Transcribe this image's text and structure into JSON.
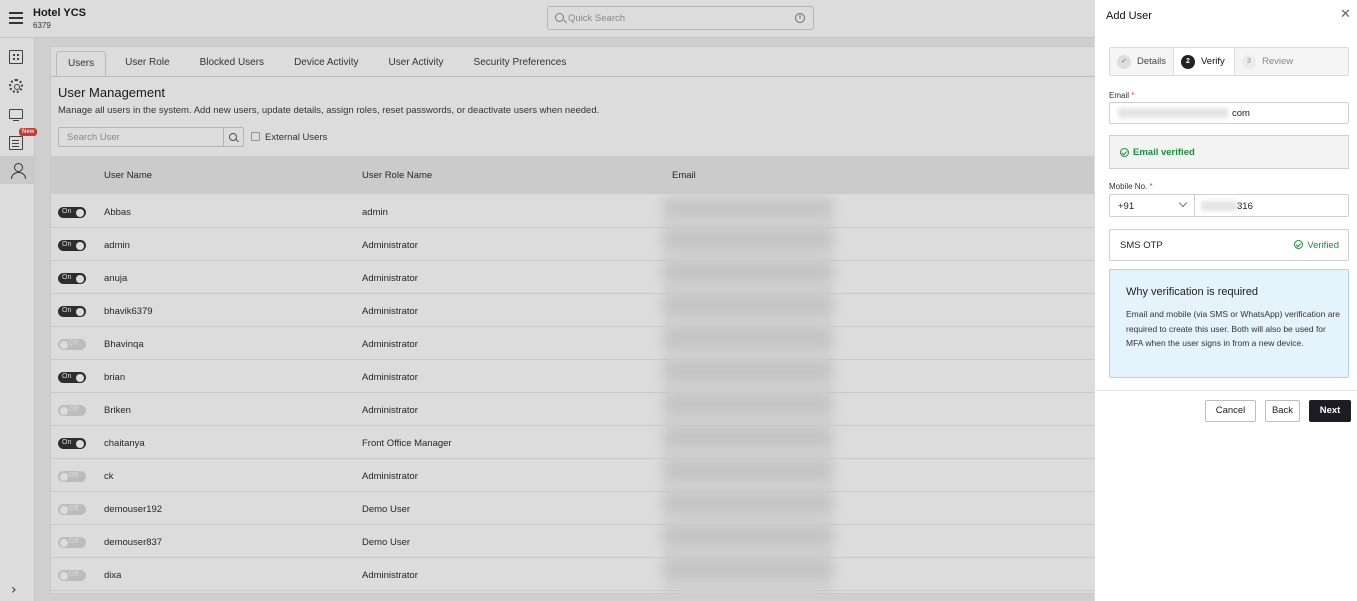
{
  "app": {
    "hotel_name": "Hotel YCS",
    "hotel_code": "6379",
    "quick_search_placeholder": "Quick Search",
    "new_badge": "New"
  },
  "tabs": [
    {
      "label": "Users",
      "active": true
    },
    {
      "label": "User Role",
      "active": false
    },
    {
      "label": "Blocked Users",
      "active": false
    },
    {
      "label": "Device Activity",
      "active": false
    },
    {
      "label": "User Activity",
      "active": false
    },
    {
      "label": "Security Preferences",
      "active": false
    }
  ],
  "page": {
    "title": "User Management",
    "description": "Manage all users in the system. Add new users, update details, assign roles, reset passwords, or deactivate users when needed.",
    "search_placeholder": "Search User",
    "external_users_label": "External Users"
  },
  "table": {
    "columns": [
      "User Name",
      "User Role Name",
      "Email"
    ],
    "rows": [
      {
        "status": "On",
        "name": "Abbas",
        "role": "admin"
      },
      {
        "status": "On",
        "name": "admin",
        "role": "Administrator"
      },
      {
        "status": "On",
        "name": "anuja",
        "role": "Administrator"
      },
      {
        "status": "On",
        "name": "bhavik6379",
        "role": "Administrator"
      },
      {
        "status": "Off",
        "name": "Bhavinqa",
        "role": "Administrator"
      },
      {
        "status": "On",
        "name": "brian",
        "role": "Administrator"
      },
      {
        "status": "Off",
        "name": "Briken",
        "role": "Administrator"
      },
      {
        "status": "On",
        "name": "chaitanya",
        "role": "Front Office Manager"
      },
      {
        "status": "Off",
        "name": "ck",
        "role": "Administrator"
      },
      {
        "status": "Off",
        "name": "demouser192",
        "role": "Demo User"
      },
      {
        "status": "Off",
        "name": "demouser837",
        "role": "Demo User"
      },
      {
        "status": "Off",
        "name": "dixa",
        "role": "Administrator"
      }
    ]
  },
  "drawer": {
    "title": "Add User",
    "close": "✕",
    "steps": [
      {
        "number": "✓",
        "label": "Details",
        "state": "done"
      },
      {
        "number": "2",
        "label": "Verify",
        "state": "current"
      },
      {
        "number": "3",
        "label": "Review",
        "state": "todo"
      }
    ],
    "email_label": "Email",
    "email_suffix": "com",
    "email_verified_text": "Email verified",
    "mobile_label": "Mobile No.",
    "country_code": "+91",
    "mobile_suffix": "316",
    "sms_otp_label": "SMS OTP",
    "sms_otp_status": "Verified",
    "info_title": "Why verification is required",
    "info_text": "Email and mobile (via SMS or WhatsApp) verification are required to create this user. Both will also be used for MFA when the user signs in from a new device.",
    "buttons": {
      "cancel": "Cancel",
      "back": "Back",
      "next": "Next"
    },
    "required_mark": "*"
  },
  "colors": {
    "success": "#1e8a3e",
    "primary_button": "#1c1c22",
    "info_bg": "#e5f3fc",
    "required": "#e53935"
  }
}
